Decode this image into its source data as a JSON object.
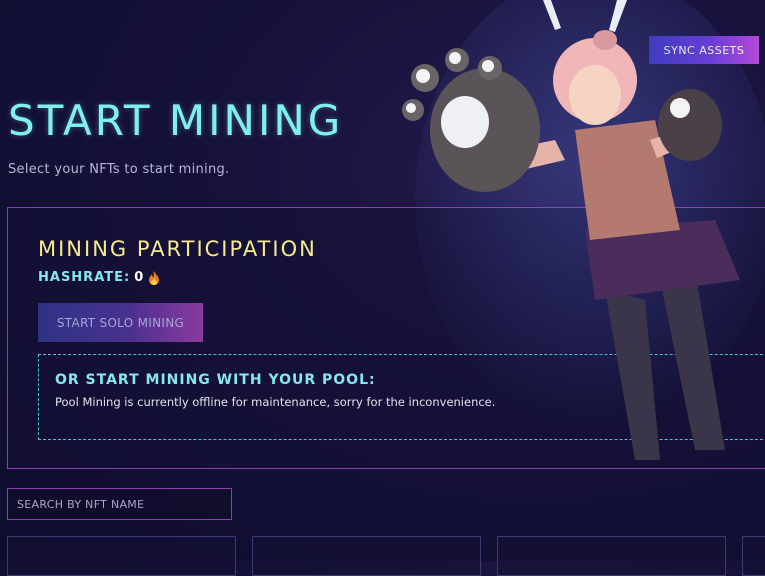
{
  "header": {
    "title": "START MINING",
    "subtitle": "Select your NFTs to start mining.",
    "sync_label": "SYNC ASSETS"
  },
  "participation": {
    "title": "MINING PARTICIPATION",
    "hashrate_label": "HASHRATE:",
    "hashrate_value": "0",
    "hashrate_icon": "fire-icon",
    "solo_button_label": "START SOLO MINING"
  },
  "pool": {
    "title": "OR START MINING WITH YOUR POOL:",
    "message": "Pool Mining is currently offline for maintenance, sorry for the inconvenience."
  },
  "search": {
    "placeholder": "SEARCH BY NFT NAME"
  },
  "colors": {
    "title": "#7ff0ec",
    "panel_title": "#f6ea8c",
    "accent_border": "#8b3fb3",
    "dashed_border": "#4cc7c9"
  }
}
